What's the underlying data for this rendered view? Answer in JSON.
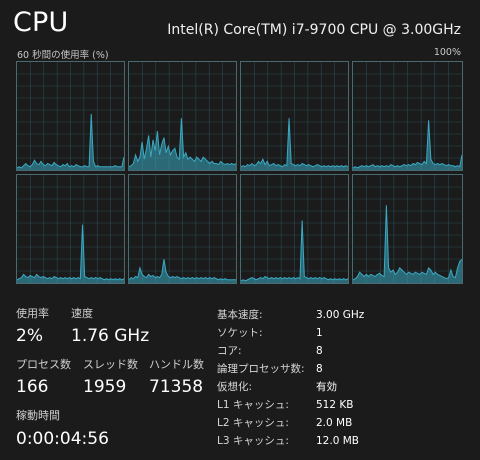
{
  "header": {
    "title": "CPU",
    "cpu_model": "Intel(R) Core(TM) i7-9700 CPU @ 3.00GHz"
  },
  "graph": {
    "caption": "60 秒間の使用率 (%)",
    "max_label": "100%",
    "line_color": "#3aa9c3",
    "fill_color": "#3aa9c3",
    "grid_color": "#294a52",
    "cores": [
      [
        2,
        3,
        2,
        4,
        6,
        4,
        3,
        5,
        9,
        6,
        5,
        8,
        5,
        4,
        6,
        5,
        4,
        7,
        5,
        4,
        3,
        5,
        4,
        6,
        3,
        4,
        3,
        5,
        4,
        3,
        3,
        4,
        3,
        3,
        52,
        8,
        3,
        4,
        3,
        3,
        3,
        3,
        3,
        3,
        3,
        4,
        3,
        3,
        3,
        12
      ],
      [
        3,
        4,
        6,
        14,
        8,
        12,
        26,
        10,
        20,
        32,
        12,
        28,
        18,
        36,
        14,
        24,
        30,
        16,
        22,
        14,
        18,
        20,
        12,
        10,
        48,
        12,
        16,
        10,
        12,
        10,
        8,
        12,
        10,
        8,
        12,
        10,
        8,
        6,
        8,
        6,
        6,
        5,
        8,
        6,
        5,
        6,
        5,
        6,
        5,
        6
      ],
      [
        3,
        4,
        3,
        5,
        4,
        6,
        4,
        5,
        8,
        6,
        10,
        5,
        8,
        4,
        5,
        6,
        4,
        5,
        4,
        3,
        5,
        4,
        48,
        6,
        5,
        4,
        5,
        4,
        6,
        5,
        4,
        5,
        4,
        3,
        4,
        5,
        4,
        3,
        4,
        3,
        4,
        3,
        4,
        3,
        4,
        3,
        4,
        3,
        4,
        3
      ],
      [
        2,
        3,
        2,
        3,
        4,
        3,
        4,
        3,
        4,
        5,
        3,
        4,
        3,
        4,
        3,
        4,
        3,
        5,
        4,
        3,
        4,
        3,
        4,
        5,
        4,
        5,
        4,
        6,
        5,
        7,
        6,
        5,
        8,
        6,
        46,
        10,
        6,
        5,
        6,
        5,
        6,
        5,
        4,
        5,
        4,
        4,
        3,
        4,
        3,
        14
      ],
      [
        3,
        4,
        5,
        8,
        6,
        5,
        7,
        6,
        5,
        8,
        6,
        5,
        6,
        5,
        4,
        5,
        4,
        6,
        5,
        4,
        5,
        4,
        5,
        4,
        5,
        4,
        5,
        4,
        5,
        4,
        54,
        6,
        5,
        4,
        5,
        4,
        5,
        4,
        5,
        4,
        3,
        4,
        3,
        4,
        3,
        4,
        3,
        4,
        3,
        4
      ],
      [
        3,
        5,
        4,
        6,
        5,
        14,
        8,
        6,
        5,
        8,
        6,
        7,
        5,
        6,
        5,
        8,
        22,
        10,
        6,
        5,
        6,
        5,
        6,
        5,
        4,
        5,
        4,
        5,
        4,
        5,
        4,
        5,
        4,
        5,
        4,
        5,
        4,
        5,
        4,
        5,
        4,
        3,
        4,
        3,
        4,
        3,
        3,
        3,
        3,
        3
      ],
      [
        2,
        3,
        2,
        3,
        4,
        5,
        4,
        3,
        4,
        5,
        4,
        6,
        5,
        4,
        5,
        4,
        5,
        4,
        5,
        4,
        5,
        4,
        5,
        4,
        5,
        4,
        5,
        4,
        58,
        6,
        5,
        4,
        5,
        4,
        5,
        4,
        5,
        4,
        5,
        4,
        3,
        4,
        3,
        4,
        3,
        4,
        3,
        4,
        3,
        4
      ],
      [
        3,
        4,
        6,
        10,
        8,
        6,
        8,
        6,
        8,
        7,
        6,
        8,
        9,
        7,
        6,
        72,
        14,
        10,
        12,
        8,
        10,
        14,
        12,
        10,
        8,
        10,
        9,
        8,
        10,
        9,
        8,
        10,
        9,
        8,
        14,
        12,
        8,
        10,
        8,
        7,
        6,
        5,
        4,
        5,
        12,
        6,
        5,
        14,
        20,
        22
      ]
    ]
  },
  "stats": {
    "utilization_label": "使用率",
    "utilization_value": "2%",
    "speed_label": "速度",
    "speed_value": "1.76 GHz",
    "processes_label": "プロセス数",
    "processes_value": "166",
    "threads_label": "スレッド数",
    "threads_value": "1959",
    "handles_label": "ハンドル数",
    "handles_value": "71358",
    "uptime_label": "稼動時間",
    "uptime_value": "0:00:04:56"
  },
  "specs": [
    {
      "label": "基本速度:",
      "value": "3.00 GHz"
    },
    {
      "label": "ソケット:",
      "value": "1"
    },
    {
      "label": "コア:",
      "value": "8"
    },
    {
      "label": "論理プロセッサ数:",
      "value": "8"
    },
    {
      "label": "仮想化:",
      "value": "有効"
    },
    {
      "label": "L1 キャッシュ:",
      "value": "512 KB"
    },
    {
      "label": "L2 キャッシュ:",
      "value": "2.0 MB"
    },
    {
      "label": "L3 キャッシュ:",
      "value": "12.0 MB"
    }
  ]
}
